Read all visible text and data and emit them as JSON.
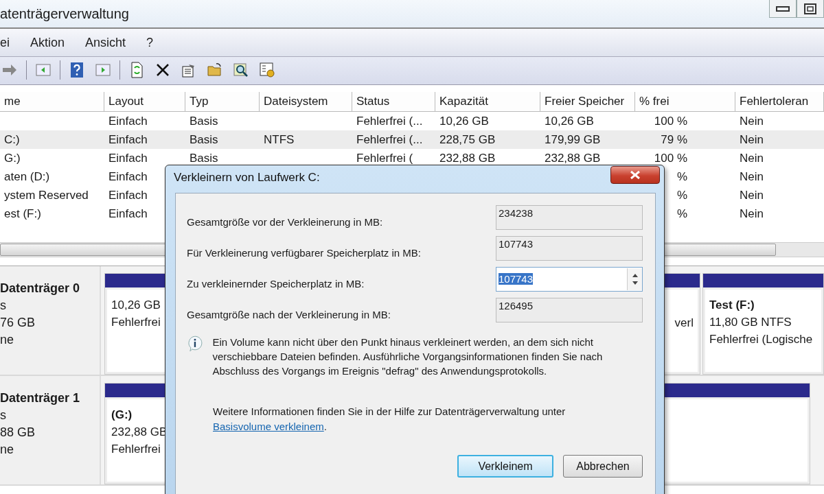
{
  "window": {
    "title": "atenträgerverwaltung"
  },
  "menu": [
    "ei",
    "Aktion",
    "Ansicht",
    "?"
  ],
  "volumes": {
    "columns": [
      "me",
      "Layout",
      "Typ",
      "Dateisystem",
      "Status",
      "Kapazität",
      "Freier Speicher",
      "% frei",
      "Fehlertoleran"
    ],
    "rows": [
      {
        "selected": false,
        "layout": "Einfach",
        "type": "Basis",
        "status": "Fehlerfrei (...",
        "capacity": "10,26 GB",
        "free_space": "10,26 GB",
        "percent_free": "100 %",
        "fault_tolerance": "Nein"
      },
      {
        "selected": true,
        "name": "C:)",
        "layout": "Einfach",
        "type": "Basis",
        "file_system": "NTFS",
        "status": "Fehlerfrei (...",
        "capacity": "228,75 GB",
        "free_space": "179,99 GB",
        "percent_free": "79 %",
        "fault_tolerance": "Nein"
      },
      {
        "selected": false,
        "name": "G:)",
        "layout": "Einfach",
        "type": "Basis",
        "status": "Fehlerfrei (",
        "capacity": "232,88 GB",
        "free_space": "232,88 GB",
        "percent_free": "100 %",
        "fault_tolerance": "Nein"
      },
      {
        "selected": false,
        "name": "aten (D:)",
        "layout": "Einfach",
        "percent_free": "%",
        "fault_tolerance": "Nein"
      },
      {
        "selected": false,
        "name": "ystem Reserved",
        "layout": "Einfach",
        "percent_free": "%",
        "fault_tolerance": "Nein"
      },
      {
        "selected": false,
        "name": "est (F:)",
        "layout": "Einfach",
        "percent_free": "%",
        "fault_tolerance": "Nein"
      }
    ]
  },
  "disks": [
    {
      "label": "Datenträger 0",
      "lines": [
        "s",
        "76 GB",
        "ne"
      ],
      "partitions": [
        {
          "lines": [
            "10,26 GB",
            "Fehlerfrei"
          ]
        },
        {
          "lines": [
            "verl"
          ]
        },
        {
          "title": "Test  (F:)",
          "lines": [
            "11,80 GB NTFS",
            "Fehlerfrei (Logische"
          ]
        }
      ]
    },
    {
      "label": "Datenträger 1",
      "lines": [
        "s",
        "88 GB",
        "ne"
      ],
      "partitions": [
        {
          "title": "(G:)",
          "lines": [
            "232,88 GB",
            "Fehlerfrei"
          ]
        }
      ]
    }
  ],
  "dialog": {
    "title": "Verkleinern von Laufwerk C:",
    "fields": [
      {
        "label": "Gesamtgröße vor der Verkleinerung in MB:",
        "value": "234238",
        "editable": false,
        "text_selected": false
      },
      {
        "label": "Für Verkleinerung verfügbarer Speicherplatz in MB:",
        "value": "107743",
        "editable": false,
        "text_selected": false
      },
      {
        "label": "Zu verkleinernder Speicherplatz in MB:",
        "value": "107743",
        "editable": true,
        "text_selected": true
      },
      {
        "label": "Gesamtgröße nach der Verkleinerung in MB:",
        "value": "126495",
        "editable": false,
        "text_selected": false
      }
    ],
    "info": "Ein Volume kann nicht über den Punkt hinaus verkleinert werden, an dem sich nicht verschiebbare Dateien befinden. Ausführliche Vorgangsinformationen finden Sie nach Abschluss des Vorgangs im Ereignis \"defrag\" des Anwendungsprotokolls.",
    "help_text": "Weitere Informationen finden Sie in der Hilfe zur Datenträgerverwaltung unter",
    "help_link": "Basisvolume verkleinem",
    "help_end": ".",
    "buttons": [
      {
        "label": "Verkleinem",
        "default": true
      },
      {
        "label": "Abbrechen",
        "default": false
      }
    ]
  }
}
